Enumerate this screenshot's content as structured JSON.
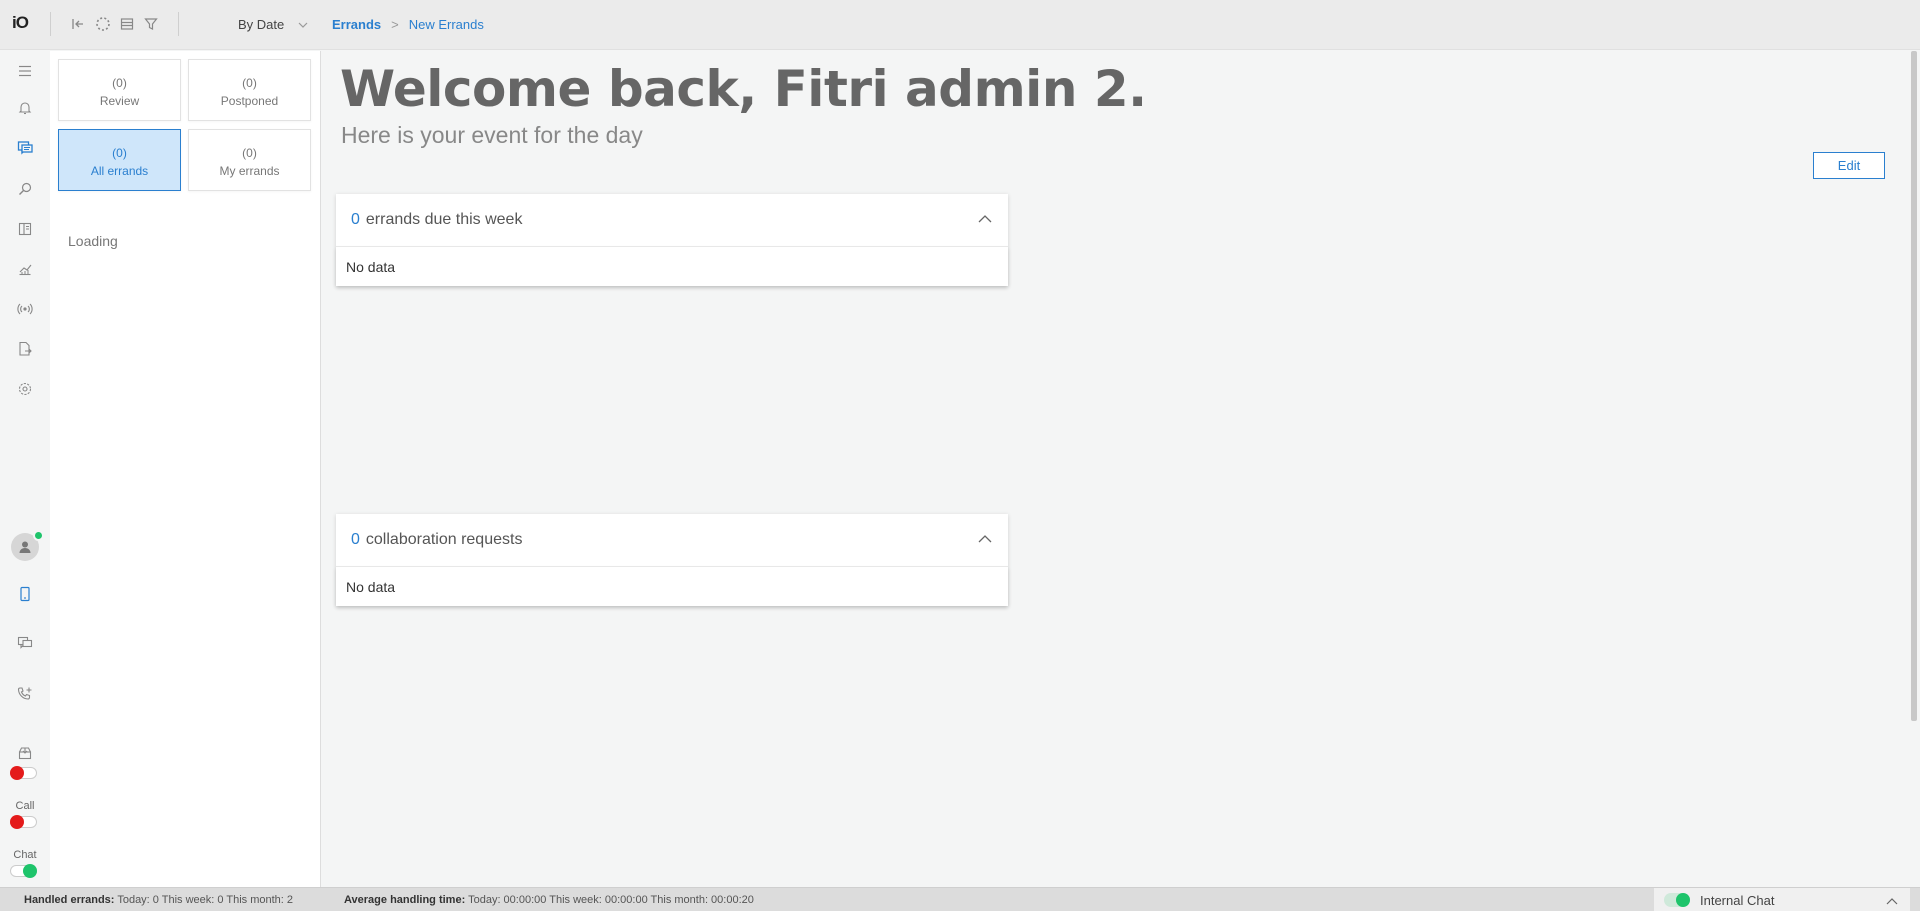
{
  "app": {
    "logo_text": "iO"
  },
  "toolbar": {
    "sort_label": "By Date",
    "icons": [
      "collapse-left-icon",
      "loading-icon",
      "list-icon",
      "filter-icon"
    ]
  },
  "breadcrumb": {
    "root": "Errands",
    "separator": ">",
    "current": "New Errands"
  },
  "rail": {
    "icons": [
      "menu-icon",
      "bell-icon",
      "errands-icon",
      "search-icon",
      "library-icon",
      "statistics-icon",
      "broadcast-icon",
      "export-icon",
      "settings-icon"
    ],
    "lower_icons": [
      "phone-device-icon",
      "chat-transfer-icon",
      "add-call-icon",
      "inbox-icon"
    ],
    "call_label": "Call",
    "chat_label": "Chat",
    "toggles": {
      "email": "off",
      "call": "off",
      "chat": "on"
    },
    "status_color": "#1ec46b"
  },
  "filters": [
    {
      "count": "(0)",
      "label": "Review",
      "active": false
    },
    {
      "count": "(0)",
      "label": "Postponed",
      "active": false
    },
    {
      "count": "(0)",
      "label": "All errands",
      "active": true
    },
    {
      "count": "(0)",
      "label": "My errands",
      "active": false
    }
  ],
  "side": {
    "loading": "Loading"
  },
  "main": {
    "welcome": "Welcome back, Fitri admin 2.",
    "subtitle": "Here is your event for the day",
    "edit_label": "Edit",
    "cards": [
      {
        "count": "0",
        "title": "errands due this week",
        "empty": "No data"
      },
      {
        "count": "0",
        "title": "collaboration requests",
        "empty": "No data"
      }
    ]
  },
  "status": {
    "handled_label": "Handled errands:",
    "handled_value": "Today: 0  This week: 0  This month: 2",
    "aht_label": "Average handling time:",
    "aht_value": "Today: 00:00:00  This week: 00:00:00  This month: 00:00:20",
    "internal_chat": "Internal Chat"
  },
  "colors": {
    "accent": "#2a7fcf",
    "online": "#1ec46b",
    "offline": "#e41b1b"
  }
}
